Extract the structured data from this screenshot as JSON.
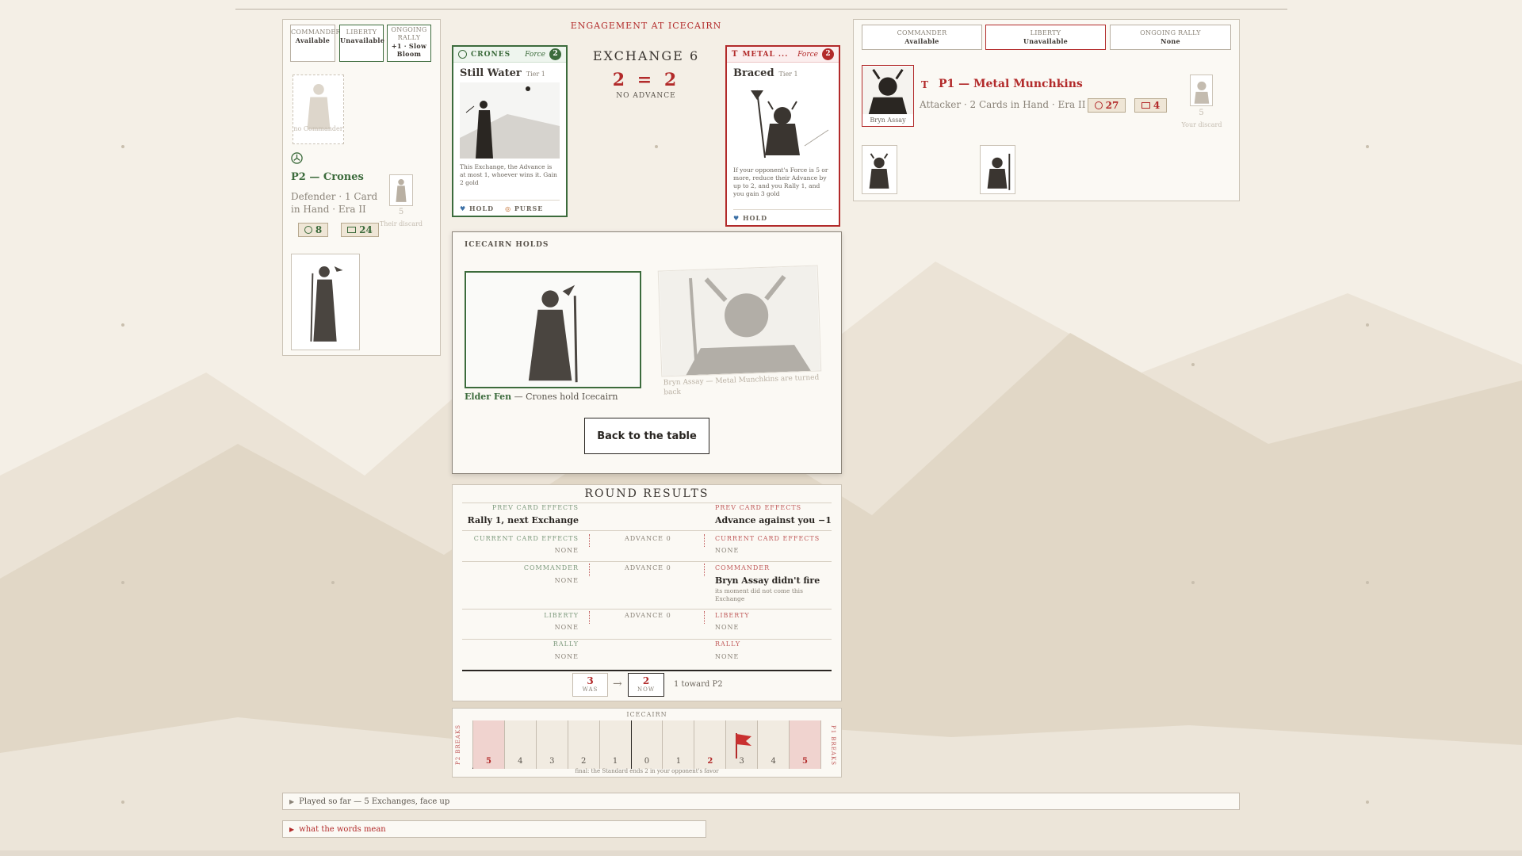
{
  "engagement_title": "ENGAGEMENT AT ICECAIRN",
  "exchange": {
    "title": "EXCHANGE 6",
    "score_left": "2",
    "score_op": "=",
    "score_right": "2",
    "subtitle": "NO ADVANCE"
  },
  "p2": {
    "status_boxes": [
      {
        "label": "COMMANDER",
        "value": "Available"
      },
      {
        "label": "LIBERTY",
        "value": "Unavailable"
      },
      {
        "label": "ONGOING RALLY",
        "value": "+1 · Slow Bloom"
      }
    ],
    "no_commander": "no Commander",
    "name": "P2 — Crones",
    "desc": "Defender · 1 Card in Hand · Era II",
    "gold": "8",
    "units": "24",
    "discard_count": "5",
    "discard_label": "Their discard"
  },
  "p1": {
    "status_boxes": [
      {
        "label": "COMMANDER",
        "value": "Available"
      },
      {
        "label": "LIBERTY",
        "value": "Unavailable"
      },
      {
        "label": "ONGOING RALLY",
        "value": "None"
      }
    ],
    "commander_name": "Bryn Assay",
    "name": "P1 — Metal Munchkins",
    "desc": "Attacker · 2 Cards in Hand · Era II",
    "gold": "27",
    "units": "4",
    "discard_count": "5",
    "discard_label": "Your discard"
  },
  "card_left": {
    "faction": "CRONES",
    "force_label": "Force",
    "force": "2",
    "title": "Still Water",
    "tier": "Tier 1",
    "text": "This Exchange, the Advance is at most 1, whoever wins it. Gain 2 gold",
    "foot": [
      "HOLD",
      "PURSE"
    ]
  },
  "card_right": {
    "faction": "METAL ...",
    "force_label": "Force",
    "force": "2",
    "title": "Braced",
    "tier": "Tier 1",
    "text": "If your opponent's Force is 5 or more, reduce their Advance by up to 2, and you Rally 1, and you gain 3 gold",
    "foot": [
      "HOLD"
    ]
  },
  "holds": {
    "title": "ICECAIRN HOLDS",
    "winner_name": "Elder Fen",
    "winner_text": " — Crones hold Icecairn",
    "loser_text": "Bryn Assay — Metal Munchkins are turned back",
    "button": "Back to the table"
  },
  "results": {
    "title": "ROUND RESULTS",
    "left_prev_label": "PREV CARD EFFECTS",
    "left_prev_value": "Rally 1, next Exchange",
    "right_prev_label": "PREV CARD EFFECTS",
    "right_prev_value": "Advance against you −1",
    "rows": [
      {
        "left_label": "CURRENT CARD EFFECTS",
        "left_value": "NONE",
        "mid": "ADVANCE 0",
        "right_label": "CURRENT CARD EFFECTS",
        "right_value": "NONE"
      },
      {
        "left_label": "COMMANDER",
        "left_value": "NONE",
        "mid": "ADVANCE 0",
        "right_label": "COMMANDER",
        "right_value": "Bryn Assay didn't fire",
        "right_note": "its moment did not come this Exchange"
      },
      {
        "left_label": "LIBERTY",
        "left_value": "NONE",
        "mid": "ADVANCE 0",
        "right_label": "LIBERTY",
        "right_value": "NONE"
      },
      {
        "left_label": "RALLY",
        "left_value": "NONE",
        "mid": "",
        "right_label": "RALLY",
        "right_value": "NONE"
      }
    ],
    "was_value": "3",
    "was_label": "WAS",
    "now_value": "2",
    "now_label": "NOW",
    "toward": "1 toward P2"
  },
  "track": {
    "title": "ICECAIRN",
    "left_label": "P2 BREAKS",
    "right_label": "P1 BREAKS",
    "cells": [
      "5",
      "4",
      "3",
      "2",
      "1",
      "0",
      "1",
      "2",
      "3",
      "4",
      "5"
    ],
    "flag_index": 8,
    "final_note": "final: the Standard ends 2 in your opponent's favor"
  },
  "details": {
    "played": "Played so far — 5 Exchanges, face up",
    "words": "what the words mean"
  },
  "colors": {
    "green": "#3c6b3c",
    "red": "#b22a2a",
    "paper": "#fbf9f4",
    "background": "#f4efe6"
  }
}
